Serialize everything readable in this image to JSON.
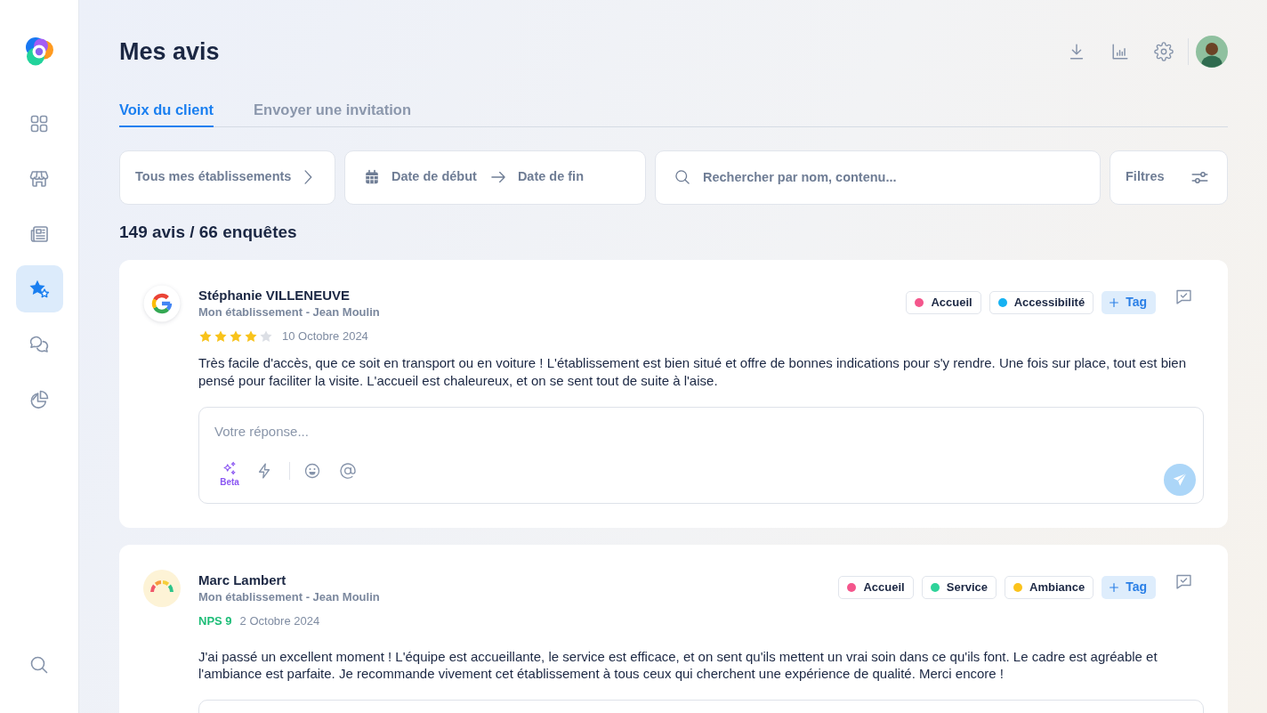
{
  "sidebar": {
    "items": [
      {
        "selected": false
      },
      {
        "selected": false
      },
      {
        "selected": false
      },
      {
        "selected": true
      },
      {
        "selected": false
      },
      {
        "selected": false
      }
    ]
  },
  "header": {
    "title": "Mes avis"
  },
  "tabs": [
    {
      "label": "Voix du client",
      "selected": true
    },
    {
      "label": "Envoyer une invitation",
      "selected": false
    }
  ],
  "filters": {
    "establishments": "Tous mes établissements",
    "date_start": "Date de début",
    "date_end": "Date de fin",
    "search": {
      "placeholder": "Rechercher par nom, contenu..."
    },
    "filters_button": "Filtres"
  },
  "summary": "149 avis / 66 enquêtes",
  "reviews": [
    {
      "kind": "google",
      "author": "Stéphanie VILLENEUVE",
      "location": "Mon établissement - Jean Moulin",
      "stars": 4,
      "date": "10 Octobre 2024",
      "text": "Très facile d'accès, que ce soit en transport ou en voiture ! L'établissement est bien situé et offre de bonnes indications pour s'y rendre. Une fois sur place, tout est bien pensé pour faciliter la visite. L'accueil est chaleureux, et on se sent tout de suite à l'aise.",
      "tags": [
        {
          "label": "Accueil",
          "color": "#f4568c"
        },
        {
          "label": "Accessibilité",
          "color": "#16b2f2"
        }
      ],
      "add_tag": "Tag",
      "reply": {
        "placeholder": "Votre réponse...",
        "beta_label": "Beta"
      }
    },
    {
      "kind": "survey",
      "author": "Marc Lambert",
      "location": "Mon établissement - Jean Moulin",
      "nps": "NPS 9",
      "date": "2 Octobre 2024",
      "text": "J'ai passé un excellent moment ! L'équipe est accueillante, le service est efficace, et on sent qu'ils mettent un vrai soin dans ce qu'ils font. Le cadre est agréable et l'ambiance est parfaite. Je recommande vivement cet établissement à tous ceux qui cherchent une expérience de qualité. Merci encore !",
      "tags": [
        {
          "label": "Accueil",
          "color": "#f4568c"
        },
        {
          "label": "Service",
          "color": "#2fd39a"
        },
        {
          "label": "Ambiance",
          "color": "#fbc31c"
        }
      ],
      "add_tag": "Tag"
    }
  ]
}
